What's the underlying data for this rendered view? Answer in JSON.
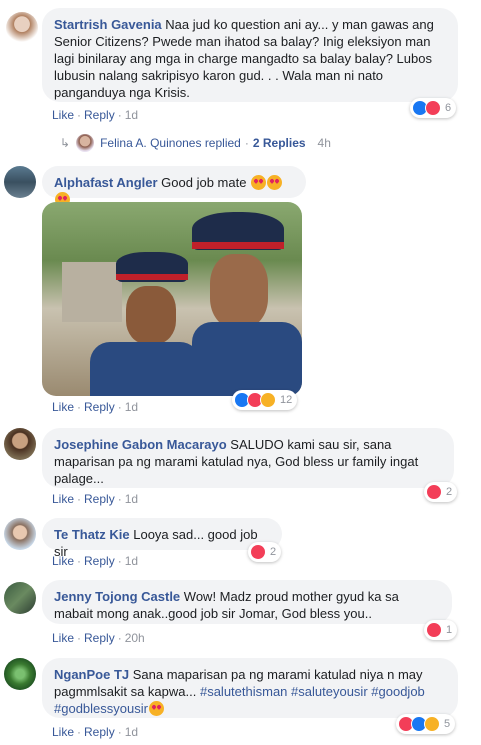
{
  "comments": [
    {
      "author": "Startrish Gavenia",
      "text": "Naa jud ko question ani ay... y man gawas ang Senior Citizens? Pwede man ihatod sa balay? Inig eleksiyon man lagi binilaray ang mga in charge mangadto sa balay balay? Lubos lubusin nalang sakripisyo karon gud. . . Wala man ni nato panganduya nga Krisis.",
      "like": "Like",
      "reply": "Reply",
      "time": "1d",
      "reactions_count": "6",
      "replies": {
        "name": "Felina A. Quinones",
        "action": "replied",
        "count": "2 Replies",
        "time": "4h"
      }
    },
    {
      "author": "Alphafast Angler",
      "text": "Good job mate",
      "like": "Like",
      "reply": "Reply",
      "time": "1d",
      "reactions_count": "12"
    },
    {
      "author": "Josephine Gabon Macarayo",
      "text": "SALUDO kami sau sir, sana maparisan pa ng marami katulad nya, God bless ur family ingat palage...",
      "like": "Like",
      "reply": "Reply",
      "time": "1d",
      "reactions_count": "2"
    },
    {
      "author": "Te Thatz Kie",
      "text": "Looya sad... good job sir",
      "like": "Like",
      "reply": "Reply",
      "time": "1d",
      "reactions_count": "2"
    },
    {
      "author": "Jenny Tojong Castle",
      "text": "Wow! Madz proud mother gyud ka sa mabait mong anak..good job sir Jomar, God bless you..",
      "like": "Like",
      "reply": "Reply",
      "time": "20h",
      "reactions_count": "1"
    },
    {
      "author": "NganPoe TJ",
      "text": "Sana maparisan pa ng marami katulad niya n may pagmmlsakit sa kapwa...",
      "hashtags": [
        "#salutethisman",
        "#saluteyousir",
        "#goodjob",
        "#godblessyousir"
      ],
      "like": "Like",
      "reply": "Reply",
      "time": "1d",
      "reactions_count": "5"
    }
  ],
  "colors": {
    "link": "#385898",
    "bubble": "#f2f3f5",
    "meta": "#90949c"
  }
}
